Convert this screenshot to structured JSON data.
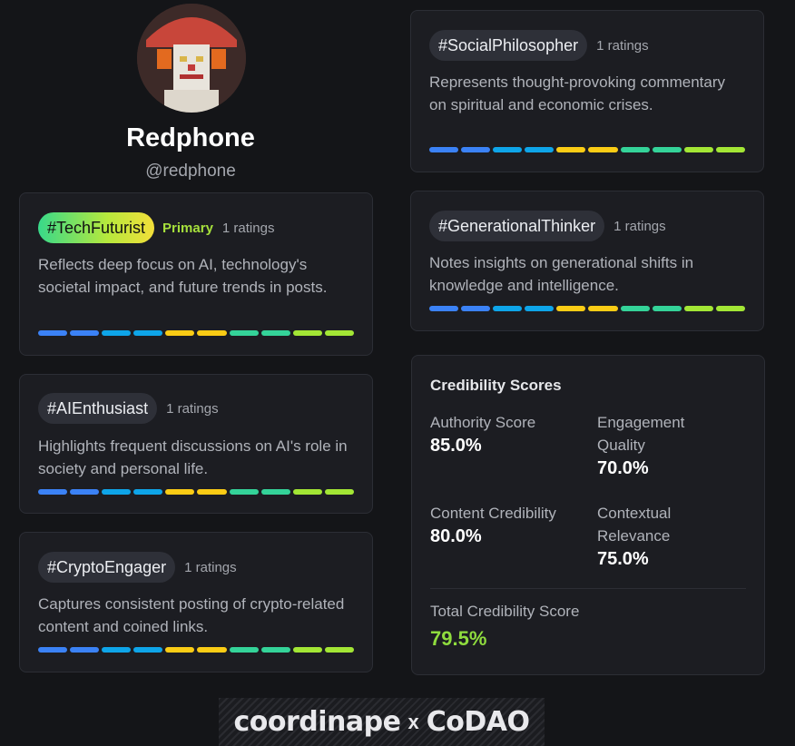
{
  "profile": {
    "name": "Redphone",
    "handle": "@redphone"
  },
  "tags": [
    {
      "tag": "#TechFuturist",
      "primary_label": "Primary",
      "ratings": "1 ratings",
      "description": "Reflects deep focus on AI, technology's societal impact, and future trends in posts."
    },
    {
      "tag": "#AIEnthusiast",
      "ratings": "1 ratings",
      "description": "Highlights frequent discussions on AI's role in society and personal life."
    },
    {
      "tag": "#CryptoEngager",
      "ratings": "1 ratings",
      "description": "Captures consistent posting of crypto-related content and coined links."
    },
    {
      "tag": "#SocialPhilosopher",
      "ratings": "1 ratings",
      "description": "Represents thought-provoking commentary on spiritual and economic crises."
    },
    {
      "tag": "#GenerationalThinker",
      "ratings": "1 ratings",
      "description": "Notes insights on generational shifts in knowledge and intelligence."
    }
  ],
  "bar_colors": [
    "#3b82f6",
    "#3b82f6",
    "#0ea5e9",
    "#0ea5e9",
    "#facc15",
    "#facc15",
    "#34d399",
    "#34d399",
    "#a3e635",
    "#a3e635"
  ],
  "credibility": {
    "title": "Credibility Scores",
    "authority_label": "Authority Score",
    "authority_value": "85.0%",
    "engagement_label": "Engagement Quality",
    "engagement_value": "70.0%",
    "content_label": "Content Credibility",
    "content_value": "80.0%",
    "contextual_label": "Contextual Relevance",
    "contextual_value": "75.0%",
    "total_label": "Total Credibility Score",
    "total_value": "79.5%"
  },
  "footer": {
    "brand_left": "coordinape",
    "separator": "x",
    "brand_right": "CoDAO"
  },
  "colors": {
    "background": "#141518",
    "card": "#1c1d22",
    "primary_accent": "#a6e03c",
    "total_score": "#8fdc3e"
  }
}
